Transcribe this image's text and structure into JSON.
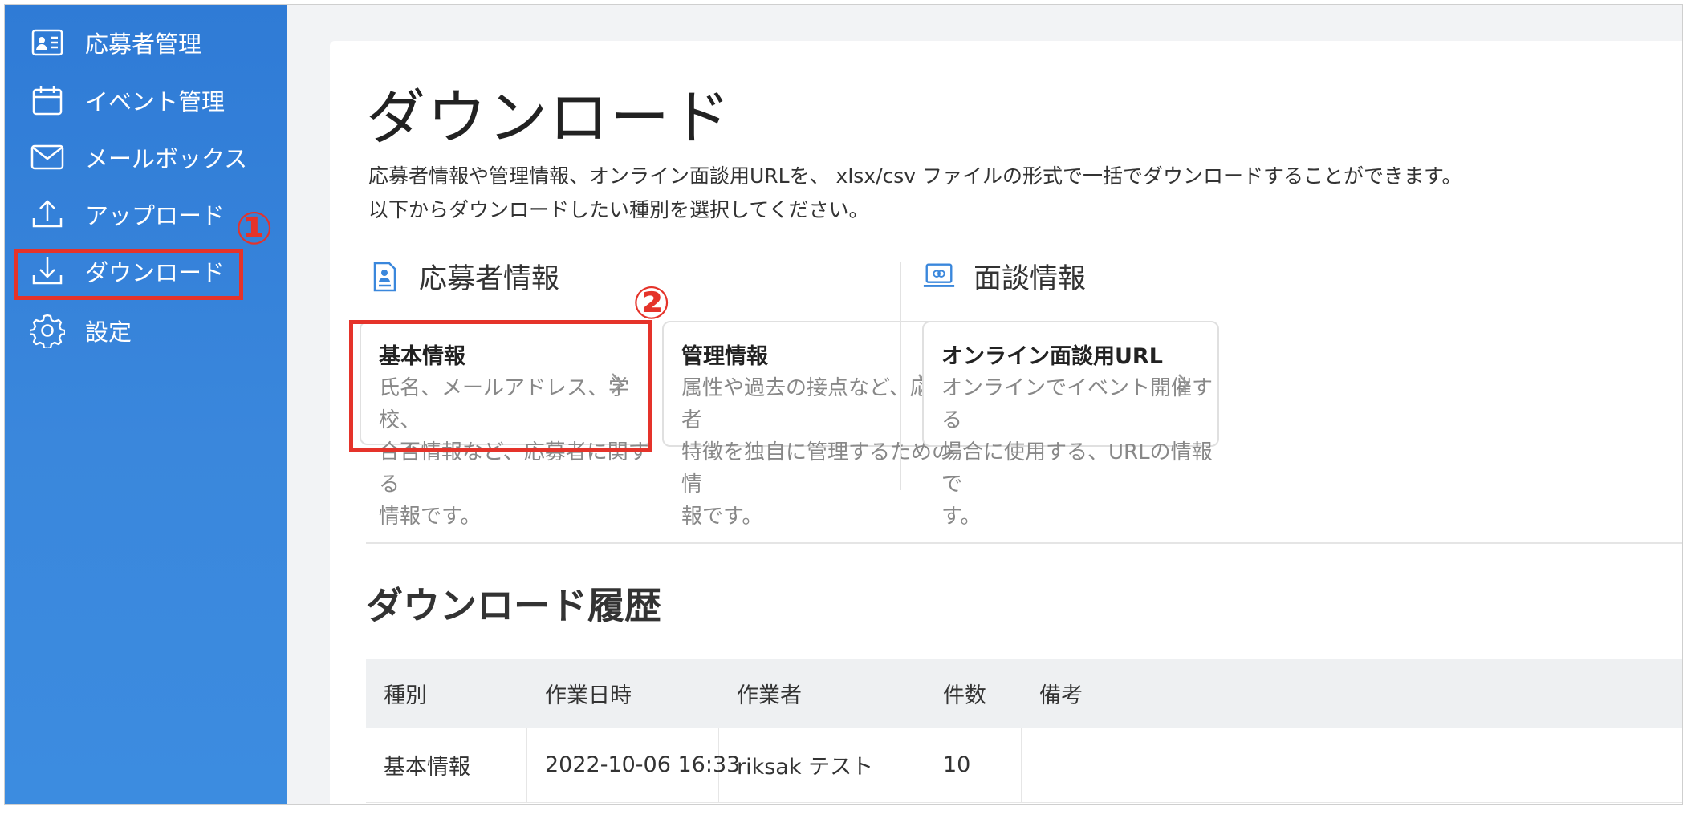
{
  "sidebar": {
    "items": [
      {
        "label": "応募者管理",
        "icon": "id-card-icon"
      },
      {
        "label": "イベント管理",
        "icon": "calendar-icon"
      },
      {
        "label": "メールボックス",
        "icon": "mail-icon"
      },
      {
        "label": "アップロード",
        "icon": "upload-icon"
      },
      {
        "label": "ダウンロード",
        "icon": "download-icon",
        "active": true
      },
      {
        "label": "設定",
        "icon": "gear-icon"
      }
    ]
  },
  "annotations": {
    "step1": "①",
    "step2": "②",
    "highlight_color": "#e5332a"
  },
  "main": {
    "title": "ダウンロード",
    "description_line1": "応募者情報や管理情報、オンライン面談用URLを、 xlsx/csv ファイルの形式で一括でダウンロードすることができます。",
    "description_line2": "以下からダウンロードしたい種別を選択してください。",
    "sections": {
      "applicant": {
        "title": "応募者情報",
        "cards": [
          {
            "title": "基本情報",
            "desc_lines": [
              "氏名、メールアドレス、学校、",
              "合否情報など、応募者に関する",
              "情報です。"
            ]
          },
          {
            "title": "管理情報",
            "desc_lines": [
              "属性や過去の接点など、応募者",
              "特徴を独自に管理するための情",
              "報です。"
            ]
          }
        ]
      },
      "interview": {
        "title": "面談情報",
        "cards": [
          {
            "title": "オンライン面談用URL",
            "desc_lines": [
              "オンラインでイベント開催する",
              "場合に使用する、URLの情報で",
              "す。"
            ]
          }
        ]
      }
    },
    "history": {
      "title": "ダウンロード履歴",
      "columns": [
        "種別",
        "作業日時",
        "作業者",
        "件数",
        "備考"
      ],
      "rows": [
        [
          "基本情報",
          "2022-10-06 16:33",
          "riksak テスト",
          "10",
          ""
        ]
      ]
    }
  }
}
